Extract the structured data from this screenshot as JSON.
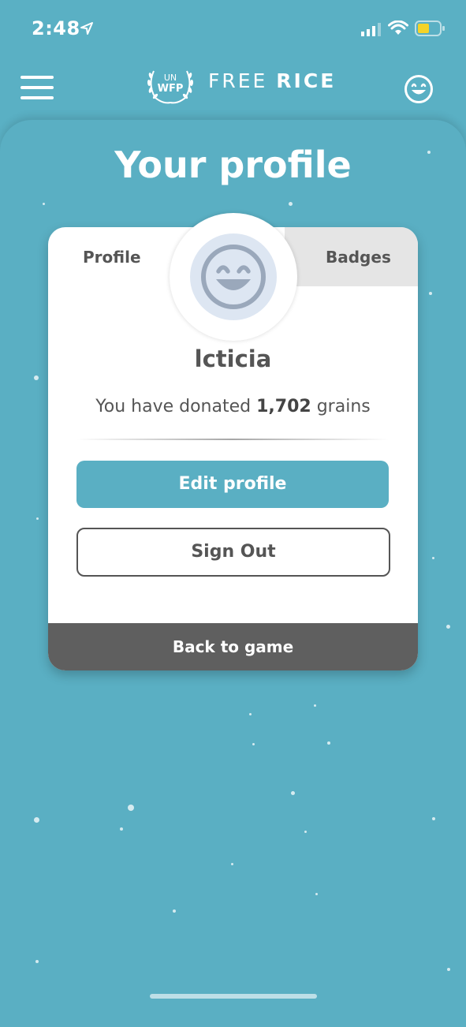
{
  "status_bar": {
    "time": "2:48",
    "icons": [
      "location-arrow-icon",
      "signal-icon",
      "wifi-icon",
      "battery-icon"
    ],
    "battery_color": "#f5d328"
  },
  "header": {
    "logo_emblem_top": "UN",
    "logo_emblem_bottom": "WFP",
    "logo_text_left": "FREE",
    "logo_text_right": "RICE",
    "menu_icon": "hamburger-menu-icon",
    "avatar_icon": "smiley-face-icon"
  },
  "page": {
    "title": "Your profile"
  },
  "card": {
    "tabs": [
      {
        "label": "Profile",
        "active": true
      },
      {
        "label": "Badges",
        "active": false
      }
    ],
    "username": "lcticia",
    "donation_prefix": "You have donated",
    "donation_count": "1,702",
    "donation_suffix": "grains",
    "edit_button": "Edit profile",
    "signout_button": "Sign Out",
    "back_button": "Back to game"
  },
  "colors": {
    "background": "#5ab0c4",
    "accent": "#5aafc3",
    "dark_button": "#5f5f5f",
    "text_gray": "#555555"
  }
}
